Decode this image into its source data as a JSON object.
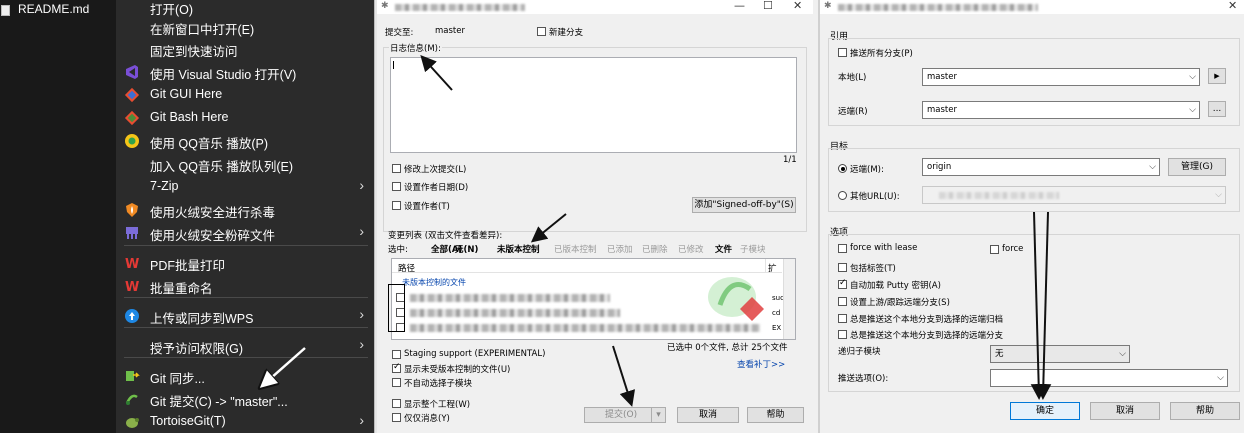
{
  "explorer": {
    "file_name": "README.md"
  },
  "context_menu": {
    "items": [
      {
        "label": "打开(O)",
        "icon": "none",
        "arrow": false
      },
      {
        "label": "在新窗口中打开(E)",
        "icon": "none",
        "arrow": false
      },
      {
        "label": "固定到快速访问",
        "icon": "none",
        "arrow": false
      },
      {
        "label": "使用 Visual Studio 打开(V)",
        "icon": "visual-studio-icon",
        "arrow": false
      },
      {
        "label": "Git GUI Here",
        "icon": "git-gui-icon",
        "arrow": false
      },
      {
        "label": "Git Bash Here",
        "icon": "git-bash-icon",
        "arrow": false
      },
      {
        "label": "使用 QQ音乐 播放(P)",
        "icon": "qq-music-icon",
        "arrow": false
      },
      {
        "label": "加入 QQ音乐 播放队列(E)",
        "icon": "none",
        "arrow": false
      },
      {
        "label": "7-Zip",
        "icon": "none",
        "arrow": true
      },
      {
        "label": "使用火绒安全进行杀毒",
        "icon": "huorong-shield-icon",
        "arrow": false
      },
      {
        "label": "使用火绒安全粉碎文件",
        "icon": "shredder-icon",
        "arrow": true
      },
      {
        "label": "PDF批量打印",
        "icon": "wps-icon",
        "arrow": false
      },
      {
        "label": "批量重命名",
        "icon": "wps-icon",
        "arrow": false
      },
      {
        "label": "上传或同步到WPS",
        "icon": "cloud-upload-icon",
        "arrow": true
      },
      {
        "label": "授予访问权限(G)",
        "icon": "none",
        "arrow": true
      },
      {
        "label": "Git 同步...",
        "icon": "tortoisegit-sync-icon",
        "arrow": false
      },
      {
        "label": "Git 提交(C) -> \"master\"...",
        "icon": "tortoisegit-commit-icon",
        "arrow": false
      },
      {
        "label": "TortoiseGit(T)",
        "icon": "tortoisegit-icon",
        "arrow": true
      }
    ]
  },
  "commit_dialog": {
    "commit_to_label": "提交至:",
    "branch": "master",
    "new_branch_label": "新建分支",
    "message_label": "日志信息(M):",
    "counter": "1/1",
    "amend_label": "修改上次提交(L)",
    "set_author_date_label": "设置作者日期(D)",
    "set_author_label": "设置作者(T)",
    "signed_off_button": "添加\"Signed-off-by\"(S)",
    "changes_label": "变更列表 (双击文件查看差异):",
    "select_label": "选中:",
    "filters": [
      {
        "label": "全部(A)",
        "style": "b"
      },
      {
        "label": "无(N)",
        "style": "b"
      },
      {
        "label": "未版本控制",
        "style": "b"
      },
      {
        "label": "已版本控制",
        "style": "dim"
      },
      {
        "label": "已添加",
        "style": "dim"
      },
      {
        "label": "已删除",
        "style": "dim"
      },
      {
        "label": "已修改",
        "style": "dim"
      },
      {
        "label": "文件",
        "style": "b"
      },
      {
        "label": "子模块",
        "style": "dim"
      }
    ],
    "col_path": "路径",
    "col_ext": "扩",
    "group_label": "未版本控制的文件",
    "ext_values": [
      "suc",
      "cd",
      "EX"
    ],
    "status_text": "已选中 0个文件, 总计 25个文件",
    "staging_label": "Staging support (EXPERIMENTAL)",
    "show_unversioned_label": "显示未受版本控制的文件(U)",
    "no_auto_submodule_label": "不自动选择子模块",
    "view_patch_link": "查看补丁>>",
    "show_whole_project_label": "显示整个工程(W)",
    "message_only_label": "仅仅消息(Y)",
    "commit_button": "提交(O)",
    "cancel_button": "取消",
    "help_button": "帮助"
  },
  "push_dialog": {
    "ref_group": "引用",
    "push_all_label": "推送所有分支(P)",
    "local_label": "本地(L)",
    "local_value": "master",
    "remote_label": "远端(R)",
    "remote_value": "master",
    "browse_button": "...",
    "target_group": "目标",
    "remote_radio_label": "远端(M):",
    "remote_name": "origin",
    "manage_button": "管理(G)",
    "other_url_label": "其他URL(U):",
    "options_group": "选项",
    "force_with_lease_label": "force with lease",
    "force_label": "force",
    "include_tags_label": "包括标签(T)",
    "auto_putty_label": "自动加载 Putty 密钥(A)",
    "set_upstream_label": "设置上游/跟踪远端分支(S)",
    "always_push_1": "总是推送这个本地分支到选择的远端归档",
    "always_push_2": "总是推送这个本地分支到选择的远端分支",
    "recurse_submodules_label": "递归子模块",
    "recurse_value": "无",
    "push_options_label": "推送选项(O):",
    "ok_button": "确定",
    "cancel_button": "取消",
    "help_button": "帮助"
  }
}
